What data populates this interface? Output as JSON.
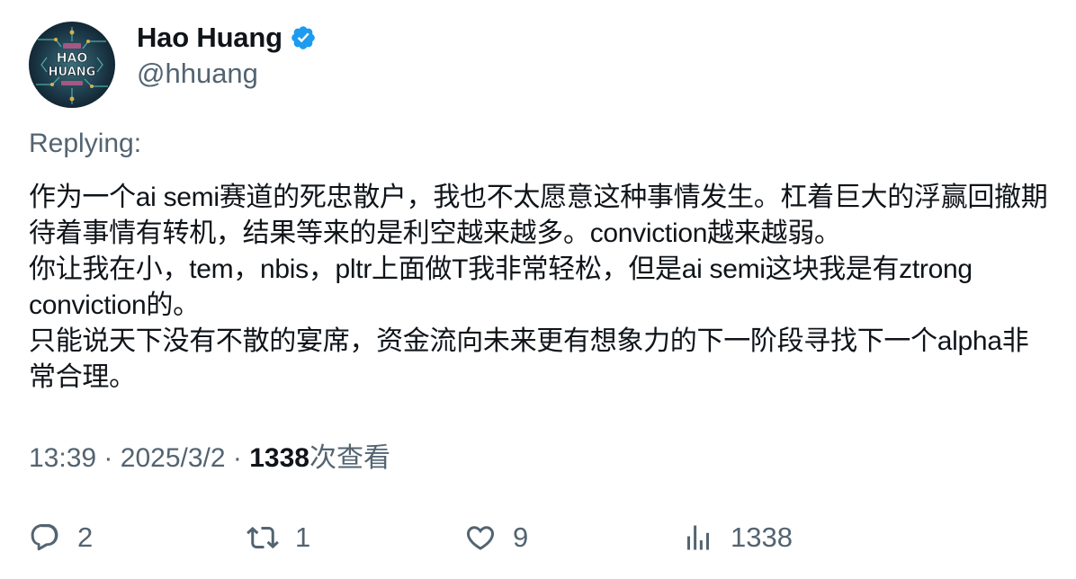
{
  "author": {
    "display_name": "Hao Huang",
    "handle": "@hhuang",
    "verified": true,
    "avatar_text_line1": "HAO",
    "avatar_text_line2": "HUANG"
  },
  "replying_label": "Replying:",
  "tweet": {
    "text": "作为一个ai semi赛道的死忠散户，我也不太愿意这种事情发生。杠着巨大的浮赢回撤期待着事情有转机，结果等来的是利空越来越多。conviction越来越弱。\n你让我在小，tem，nbis，pltr上面做T我非常轻松，但是ai semi这块我是有ztrong conviction的。\n只能说天下没有不散的宴席，资金流向未来更有想象力的下一阶段寻找下一个alpha非常合理。"
  },
  "meta": {
    "time": "13:39",
    "separator": "·",
    "date": "2025/3/2",
    "views_count": "1338",
    "views_label": "次查看"
  },
  "actions": {
    "reply_count": "2",
    "retweet_count": "1",
    "like_count": "9",
    "views_count": "1338"
  },
  "colors": {
    "text_primary": "#0f1419",
    "text_secondary": "#536471",
    "verified_blue": "#1d9bf0"
  },
  "icons": {
    "verified": "verified-badge-icon",
    "reply": "reply-icon",
    "retweet": "retweet-icon",
    "like": "heart-icon",
    "views": "analytics-icon"
  }
}
